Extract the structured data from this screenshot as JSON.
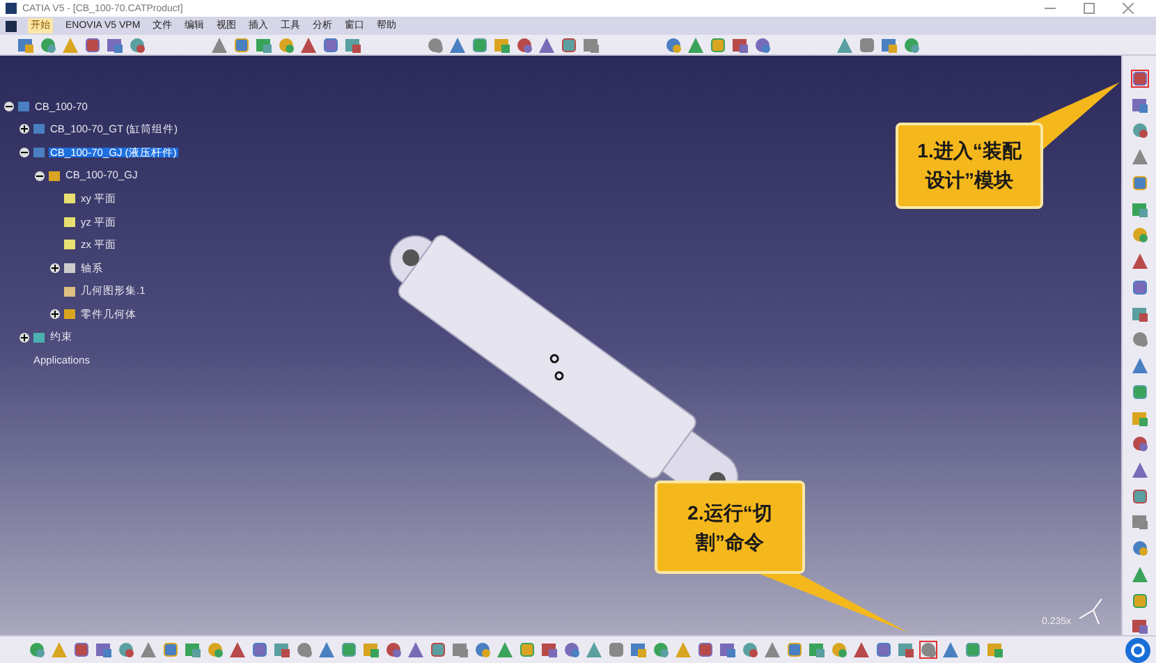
{
  "window": {
    "title": "CATIA V5 - [CB_100-70.CATProduct]"
  },
  "menu": [
    {
      "label": "开始",
      "selected": true
    },
    {
      "label": "ENOVIA V5 VPM",
      "selected": false
    },
    {
      "label": "文件",
      "selected": false
    },
    {
      "label": "编辑",
      "selected": false
    },
    {
      "label": "视图",
      "selected": false
    },
    {
      "label": "插入",
      "selected": false
    },
    {
      "label": "工具",
      "selected": false
    },
    {
      "label": "分析",
      "selected": false
    },
    {
      "label": "窗口",
      "selected": false
    },
    {
      "label": "帮助",
      "selected": false
    }
  ],
  "tree": [
    {
      "label": "CB_100-70",
      "kind": "product",
      "selected": false,
      "expanded": true,
      "children": [
        {
          "label": "CB_100-70_GT (缸筒组件)",
          "kind": "product",
          "selected": false,
          "expanded": false
        },
        {
          "label": "CB_100-70_GJ (液压杆件)",
          "kind": "product",
          "selected": true,
          "expanded": true,
          "children": [
            {
              "label": "CB_100-70_GJ",
              "kind": "part",
              "selected": false,
              "expanded": true,
              "children": [
                {
                  "label": "xy 平面",
                  "kind": "plane",
                  "selected": false
                },
                {
                  "label": "yz 平面",
                  "kind": "plane",
                  "selected": false
                },
                {
                  "label": "zx 平面",
                  "kind": "plane",
                  "selected": false
                },
                {
                  "label": "轴系",
                  "kind": "axis",
                  "selected": false,
                  "expanded": false
                },
                {
                  "label": "几何图形集.1",
                  "kind": "geoset",
                  "selected": false
                },
                {
                  "label": "零件几何体",
                  "kind": "body",
                  "selected": false,
                  "expanded": false
                }
              ]
            }
          ]
        },
        {
          "label": "约束",
          "kind": "constraints",
          "selected": false,
          "expanded": false
        },
        {
          "label": "Applications",
          "kind": "text",
          "selected": false
        }
      ]
    }
  ],
  "callouts": [
    {
      "text": "1.进入“装配设计”模块"
    },
    {
      "text": "2.运行“切割”命令"
    }
  ],
  "view": {
    "scale": "0.235x"
  }
}
